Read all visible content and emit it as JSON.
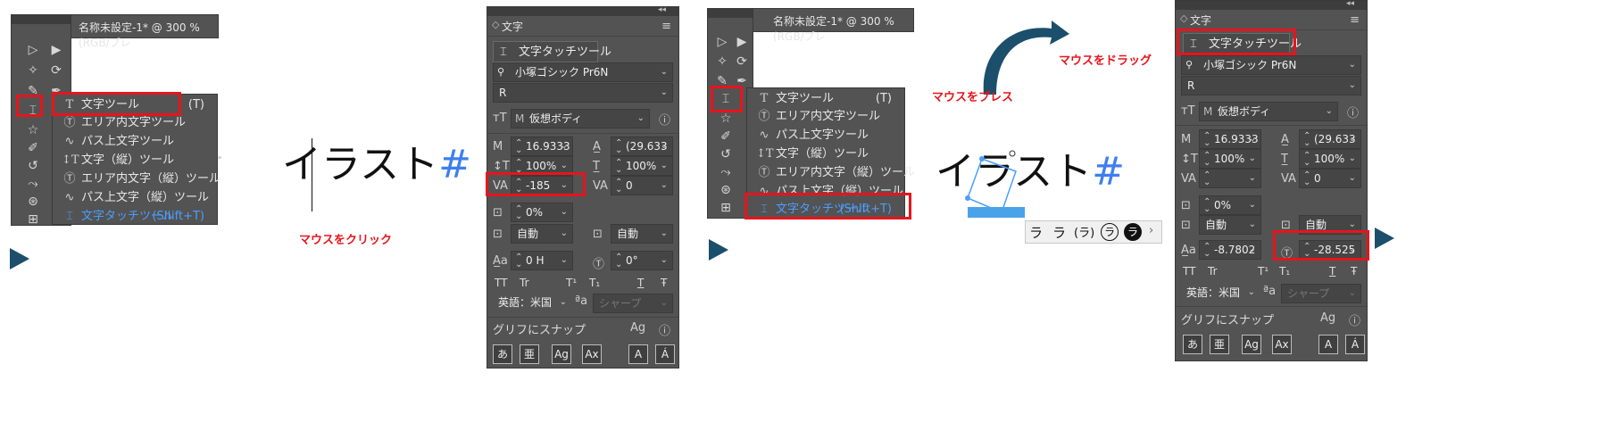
{
  "doc_tab_title": "名称未設定-1* @ 300 % (RGB/プレ",
  "menu": {
    "items": [
      {
        "label": "文字ツール",
        "shortcut": "(T)"
      },
      {
        "label": "エリア内文字ツール",
        "shortcut": ""
      },
      {
        "label": "パス上文字ツール",
        "shortcut": ""
      },
      {
        "label": "文字（縦）ツール",
        "shortcut": ""
      },
      {
        "label": "エリア内文字（縦）ツール",
        "shortcut": ""
      },
      {
        "label": "パス上文字（縦）ツール",
        "shortcut": ""
      },
      {
        "label": "文字タッチツール",
        "shortcut": "(Shift+T)"
      }
    ],
    "selected_index": 6
  },
  "illustration_text": {
    "main": "イラスト",
    "hash": "#"
  },
  "annotations": {
    "click": "マウスをクリック",
    "press": "マウスをプレス",
    "drag": "マウスをドラッグ"
  },
  "char_panel": {
    "title": "文字",
    "touch_tool": "文字タッチツール",
    "font_family": "小塚ゴシック Pr6N",
    "font_style": "R",
    "virtual_body": "仮想ボディ",
    "font_size": "16.9333",
    "leading": "(29.633",
    "vscale": "100%",
    "hscale": "100%",
    "kerning_1": "-185",
    "kerning_2": "",
    "tracking": "0",
    "tsume": "0%",
    "aki_left": "自動",
    "aki_right": "自動",
    "baseline_1": "0 H",
    "rotation_1": "0°",
    "baseline_2": "-8.7802",
    "rotation_2": "-28.525",
    "language": "英語：米国",
    "aa_method": "シャープ",
    "snap_label": "グリフにスナップ",
    "style_buttons": [
      "TT",
      "Tr",
      "T¹",
      "T₁",
      "T",
      "Ŧ"
    ],
    "bottom_buttons": [
      "あ",
      "亜",
      "Ag",
      "Ax",
      "A",
      "Á"
    ]
  },
  "glyph_strip": [
    "ラ",
    "ラ",
    "(ラ)",
    "ラ",
    "ラ",
    "›"
  ],
  "colors": {
    "red": "#e8141c",
    "panel": "#535353",
    "accent_blue": "#4a9eff",
    "arrow": "#1b4f6b"
  }
}
